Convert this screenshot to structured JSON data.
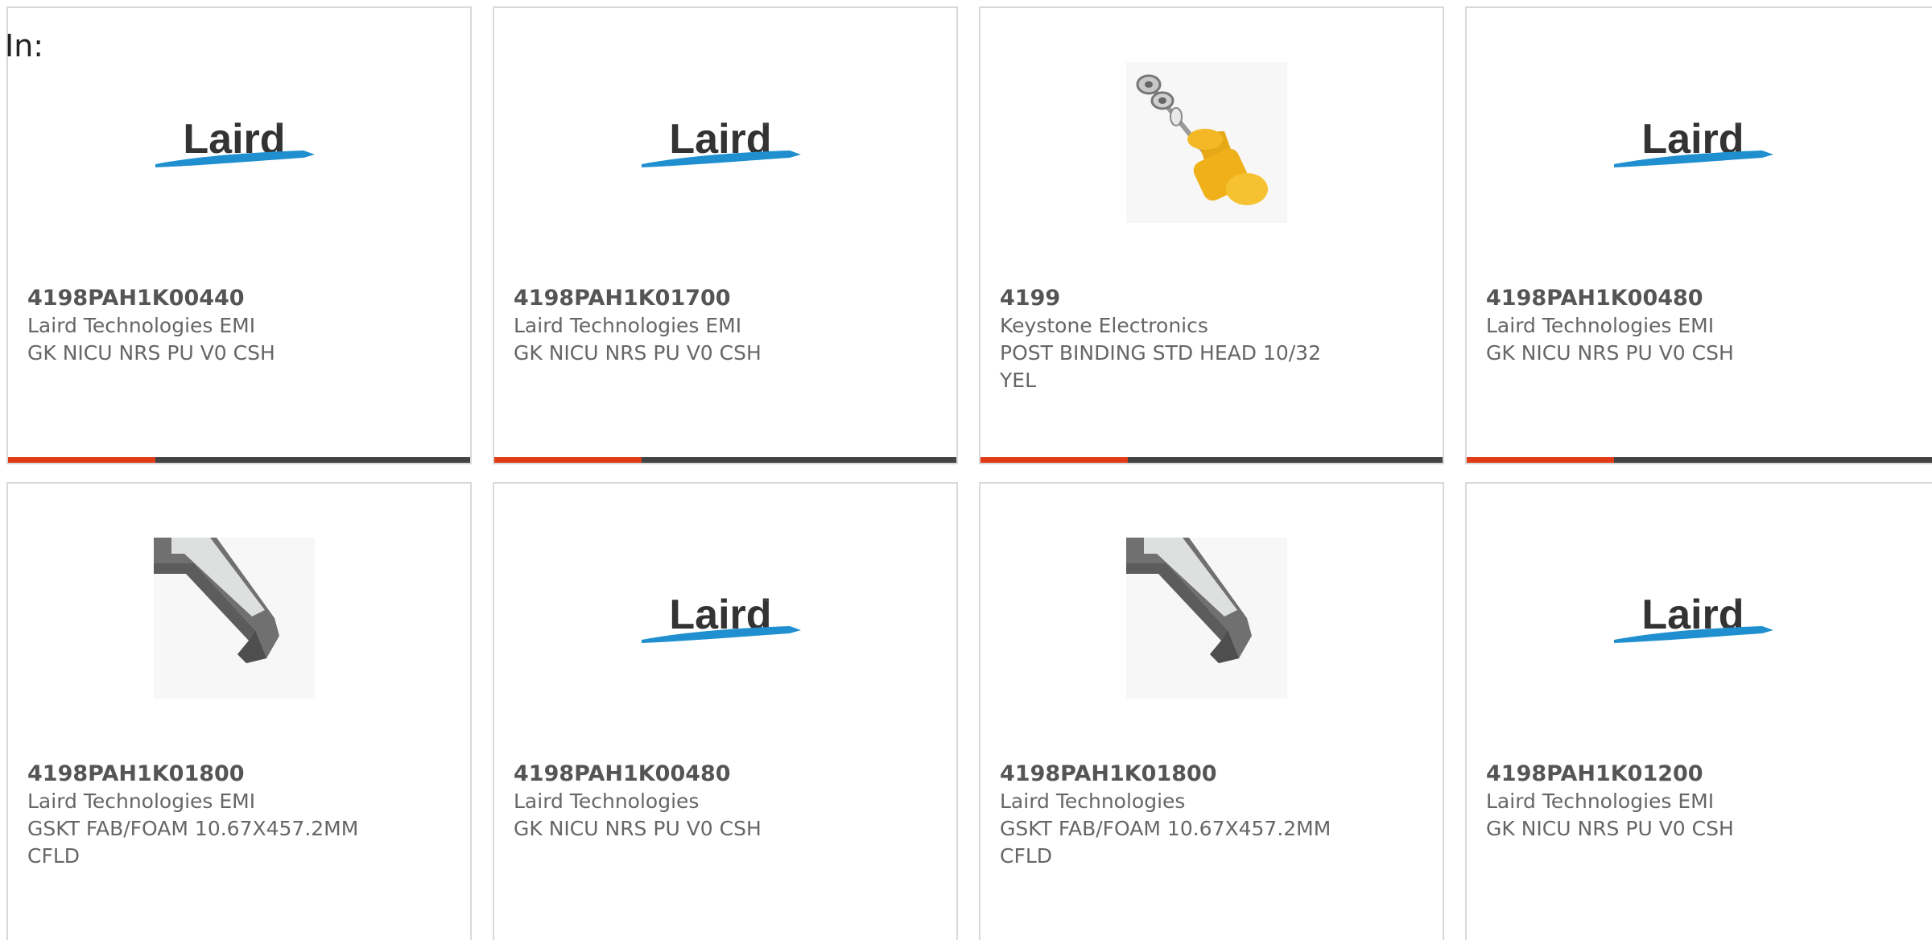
{
  "header": {
    "in_label": "In:"
  },
  "logo": {
    "text": "Laird",
    "tm": "™"
  },
  "colors": {
    "border": "#d9d9d9",
    "text": "#666666",
    "bar_dark": "#414345",
    "bar_accent": "#e03b16",
    "laird_blue": "#1f8fcf"
  },
  "products": [
    {
      "part_number": "4198PAH1K00440",
      "manufacturer": "Laird Technologies EMI",
      "description": "GK NICU NRS PU V0 CSH",
      "image": "laird-logo"
    },
    {
      "part_number": "4198PAH1K01700",
      "manufacturer": "Laird Technologies EMI",
      "description": "GK NICU NRS PU V0 CSH",
      "image": "laird-logo"
    },
    {
      "part_number": "4199",
      "manufacturer": "Keystone Electronics",
      "description": "POST BINDING STD HEAD 10/32 YEL",
      "image": "binding-post-photo"
    },
    {
      "part_number": "4198PAH1K00480",
      "manufacturer": "Laird Technologies EMI",
      "description": "GK NICU NRS PU V0 CSH",
      "image": "laird-logo"
    },
    {
      "part_number": "4198PAH1K01800",
      "manufacturer": "Laird Technologies EMI",
      "description": "GSKT FAB/FOAM 10.67X457.2MM CFLD",
      "image": "gasket-photo"
    },
    {
      "part_number": "4198PAH1K00480",
      "manufacturer": "Laird Technologies",
      "description": "GK NICU NRS PU V0 CSH",
      "image": "laird-logo"
    },
    {
      "part_number": "4198PAH1K01800",
      "manufacturer": "Laird Technologies",
      "description": "GSKT FAB/FOAM 10.67X457.2MM CFLD",
      "image": "gasket-photo"
    },
    {
      "part_number": "4198PAH1K01200",
      "manufacturer": "Laird Technologies EMI",
      "description": "GK NICU NRS PU V0 CSH",
      "image": "laird-logo"
    }
  ]
}
